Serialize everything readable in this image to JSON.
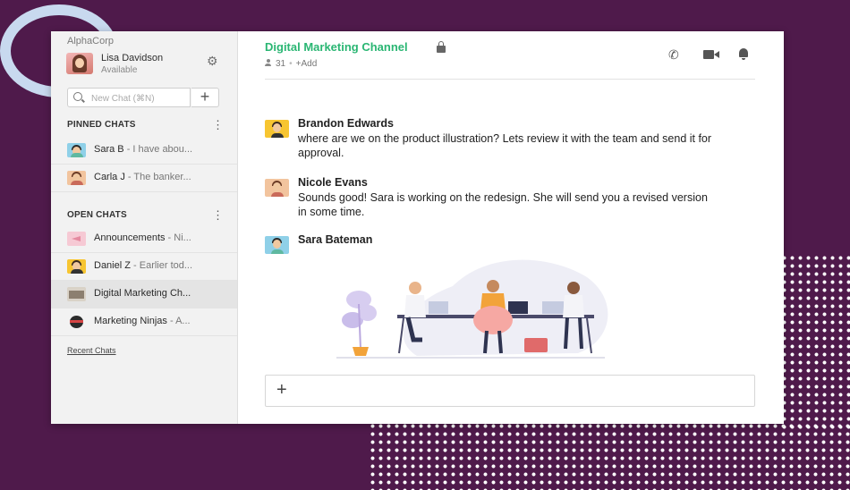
{
  "app": {
    "org": "AlphaCorp",
    "user": {
      "name": "Lisa Davidson",
      "status": "Available"
    },
    "search_placeholder": "New Chat (⌘N)"
  },
  "sidebar": {
    "pinned_title": "PINNED CHATS",
    "pinned": [
      {
        "name": "Sara B",
        "preview": " - I have abou..."
      },
      {
        "name": "Carla J",
        "preview": " - The banker..."
      }
    ],
    "open_title": "OPEN CHATS",
    "open": [
      {
        "name": "Announcements",
        "preview": " - Ni..."
      },
      {
        "name": "Daniel Z",
        "preview": " - Earlier tod..."
      },
      {
        "name": "Digital Marketing Ch...",
        "preview": ""
      },
      {
        "name": "Marketing Ninjas",
        "preview": " - A..."
      }
    ],
    "recent_link": "Recent Chats"
  },
  "channel": {
    "title": "Digital Marketing Channel",
    "member_count": "31",
    "add_label": "+Add"
  },
  "messages": [
    {
      "author": "Brandon Edwards",
      "text": "where are we on the product illustration? Lets review it with the team and send it for approval."
    },
    {
      "author": "Nicole Evans",
      "text": "Sounds good! Sara is working on the redesign. She will send you a revised version in some time."
    },
    {
      "author": "Sara Bateman",
      "text": ""
    }
  ],
  "colors": {
    "accent": "#2ab673",
    "background": "#4f1a4b",
    "ring": "#c8d9ef"
  },
  "icons": [
    "gear-icon",
    "search-icon",
    "plus-icon",
    "kebab-icon",
    "lock-icon",
    "person-icon",
    "phone-icon",
    "video-icon",
    "bell-icon"
  ]
}
